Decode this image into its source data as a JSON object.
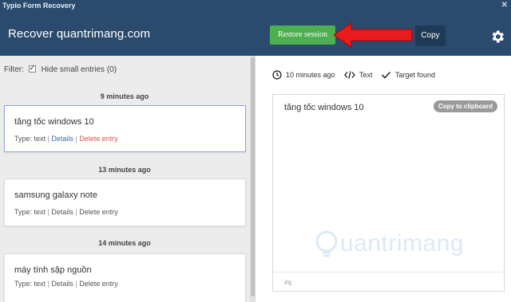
{
  "window": {
    "title": "Typio Form Recovery",
    "close_glyph": "✕"
  },
  "header": {
    "title": "Recover quantrimang.com",
    "restore_label": "Restore session",
    "copy_label": "Copy",
    "accent_green": "#4caf50",
    "header_bg": "#2a4b6d"
  },
  "filter": {
    "label": "Filter:",
    "option_label": "Hide small entries (0)",
    "checked": true
  },
  "groups": [
    {
      "time_label": "9 minutes ago",
      "entry": {
        "text": "tăng tốc windows 10",
        "type": "Type: text",
        "details": "Details",
        "delete": "Delete entry",
        "selected": true
      }
    },
    {
      "time_label": "13 minutes ago",
      "entry": {
        "text": "samsung galaxy note",
        "type": "Type: text",
        "details": "Details",
        "delete": "Delete entry",
        "selected": false
      }
    },
    {
      "time_label": "14 minutes ago",
      "entry": {
        "text": "máy tính sập nguồn",
        "type": "Type: text",
        "details": "Details",
        "delete": "Delete entry",
        "selected": false
      }
    }
  ],
  "separator": "|",
  "detail": {
    "time": "10 minutes ago",
    "format": "Text",
    "target": "Target found",
    "content": "tăng tốc windows 10",
    "clipboard_label": "Copy to clipboard",
    "tag": "#q",
    "watermark": "uantrimang"
  },
  "icons": {
    "clock": "clock-icon",
    "code": "code-icon",
    "check": "check-icon",
    "gear": "gear-icon",
    "arrow": "arrow-icon"
  }
}
